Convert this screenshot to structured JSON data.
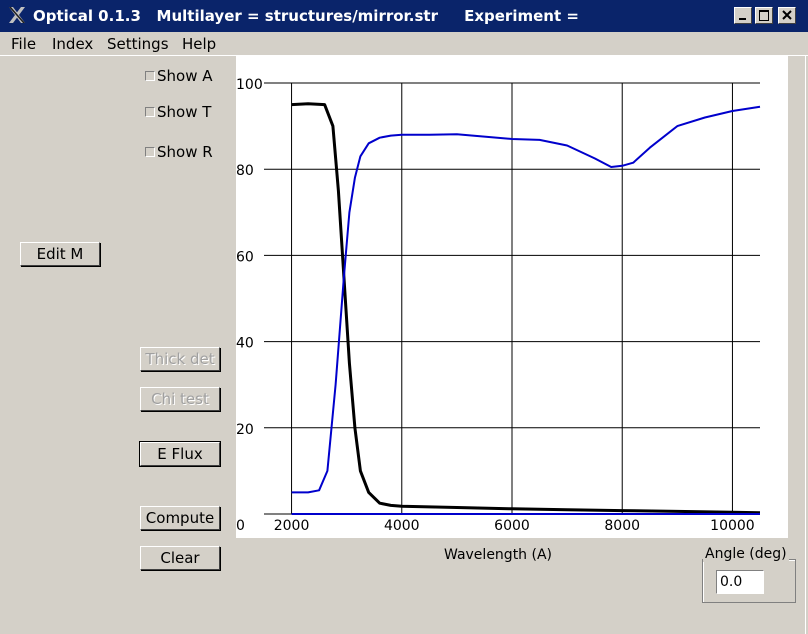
{
  "window": {
    "title": "Optical 0.1.3   Multilayer = structures/mirror.str     Experiment =",
    "controls": [
      "minimize-icon",
      "maximize-icon",
      "close-icon"
    ]
  },
  "menu": {
    "items": [
      "File",
      "Index",
      "Settings",
      "Help"
    ]
  },
  "checkboxes": {
    "show_a": "Show A",
    "show_t": "Show T",
    "show_r": "Show R"
  },
  "buttons": {
    "edit_m": "Edit M",
    "thick_det": "Thick det",
    "chi_test": "Chi test",
    "e_flux": "E Flux",
    "compute": "Compute",
    "clear": "Clear"
  },
  "angle": {
    "label": "Angle (deg)",
    "value": "0.0"
  },
  "chart_data": {
    "type": "line",
    "xlabel": "Wavelength (A)",
    "ylabel": "",
    "xlim": [
      1500,
      10500
    ],
    "ylim": [
      0,
      100
    ],
    "xticks": [
      2000,
      4000,
      6000,
      8000,
      10000
    ],
    "yticks": [
      0,
      20,
      40,
      60,
      80,
      100
    ],
    "grid": true,
    "colors": {
      "black": "#000000",
      "blue": "#0000cc"
    },
    "series": [
      {
        "color": "#000000",
        "x": [
          2000,
          2300,
          2600,
          2750,
          2850,
          2950,
          3050,
          3150,
          3250,
          3400,
          3600,
          3800,
          4000,
          5000,
          6000,
          7000,
          8000,
          9000,
          10000,
          10500
        ],
        "y": [
          95,
          95.2,
          95,
          90,
          75,
          55,
          35,
          20,
          10,
          5,
          2.5,
          2,
          1.8,
          1.5,
          1.2,
          1,
          0.8,
          0.6,
          0.4,
          0.3
        ]
      },
      {
        "color": "#0000cc",
        "x": [
          2000,
          2300,
          2500,
          2650,
          2800,
          2950,
          3050,
          3150,
          3250,
          3400,
          3600,
          3800,
          4000,
          4500,
          5000,
          6000,
          6500,
          7000,
          7500,
          7800,
          8000,
          8200,
          8500,
          9000,
          9500,
          10000,
          10500
        ],
        "y": [
          5,
          5,
          5.5,
          10,
          30,
          55,
          70,
          78,
          83,
          86,
          87.3,
          87.8,
          88,
          88,
          88.1,
          87,
          86.8,
          85.5,
          82.5,
          80.5,
          80.8,
          81.5,
          85,
          90,
          92,
          93.5,
          94.5
        ]
      },
      {
        "color": "#0000cc",
        "x": [
          2000,
          10500
        ],
        "y": [
          0,
          0
        ]
      }
    ]
  }
}
